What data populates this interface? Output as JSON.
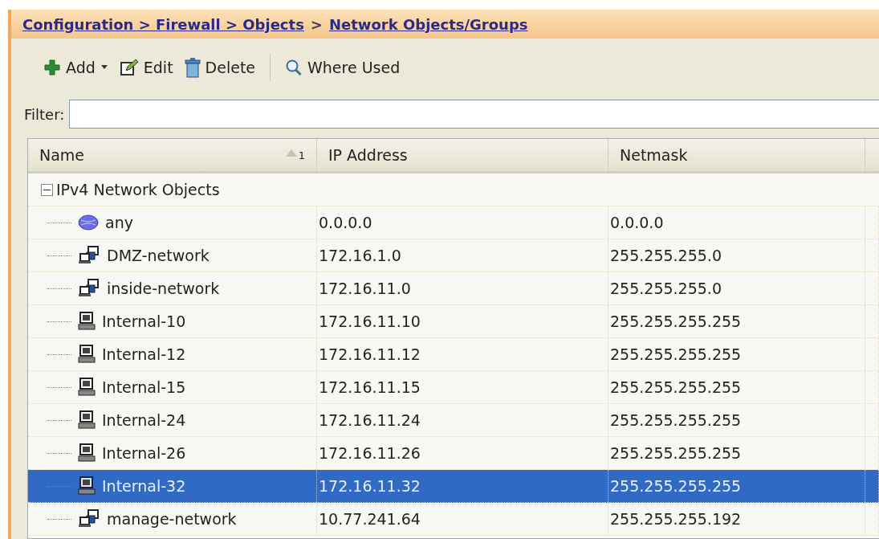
{
  "breadcrumb": {
    "separator": ">",
    "links": [
      {
        "label": "Configuration > Firewall > Objects"
      },
      {
        "label": "Network Objects/Groups"
      }
    ]
  },
  "toolbar": [
    {
      "kind": "add",
      "label": "Add",
      "has_menu": true
    },
    {
      "kind": "edit",
      "label": "Edit",
      "has_menu": false
    },
    {
      "kind": "delete",
      "label": "Delete",
      "has_menu": false
    },
    {
      "kind": "search",
      "label": "Where Used",
      "has_menu": false
    }
  ],
  "filter": {
    "label": "Filter:"
  },
  "table": {
    "columns": [
      {
        "label": "Name",
        "sort_order": "1"
      },
      {
        "label": "IP Address"
      },
      {
        "label": "Netmask"
      }
    ],
    "groups": [
      {
        "label": "IPv4 Network Objects",
        "expanded": true,
        "children": [
          {
            "kind": "any",
            "name": "any",
            "ip": "0.0.0.0",
            "netmask": "0.0.0.0",
            "selected": false
          },
          {
            "kind": "network",
            "name": "DMZ-network",
            "ip": "172.16.1.0",
            "netmask": "255.255.255.0",
            "selected": false
          },
          {
            "kind": "network",
            "name": "inside-network",
            "ip": "172.16.11.0",
            "netmask": "255.255.255.0",
            "selected": false
          },
          {
            "kind": "host",
            "name": "Internal-10",
            "ip": "172.16.11.10",
            "netmask": "255.255.255.255",
            "selected": false
          },
          {
            "kind": "host",
            "name": "Internal-12",
            "ip": "172.16.11.12",
            "netmask": "255.255.255.255",
            "selected": false
          },
          {
            "kind": "host",
            "name": "Internal-15",
            "ip": "172.16.11.15",
            "netmask": "255.255.255.255",
            "selected": false
          },
          {
            "kind": "host",
            "name": "Internal-24",
            "ip": "172.16.11.24",
            "netmask": "255.255.255.255",
            "selected": false
          },
          {
            "kind": "host",
            "name": "Internal-26",
            "ip": "172.16.11.26",
            "netmask": "255.255.255.255",
            "selected": false
          },
          {
            "kind": "host",
            "name": "Internal-32",
            "ip": "172.16.11.32",
            "netmask": "255.255.255.255",
            "selected": true
          },
          {
            "kind": "network",
            "name": "manage-network",
            "ip": "10.77.241.64",
            "netmask": "255.255.255.192",
            "selected": false
          }
        ]
      }
    ]
  }
}
